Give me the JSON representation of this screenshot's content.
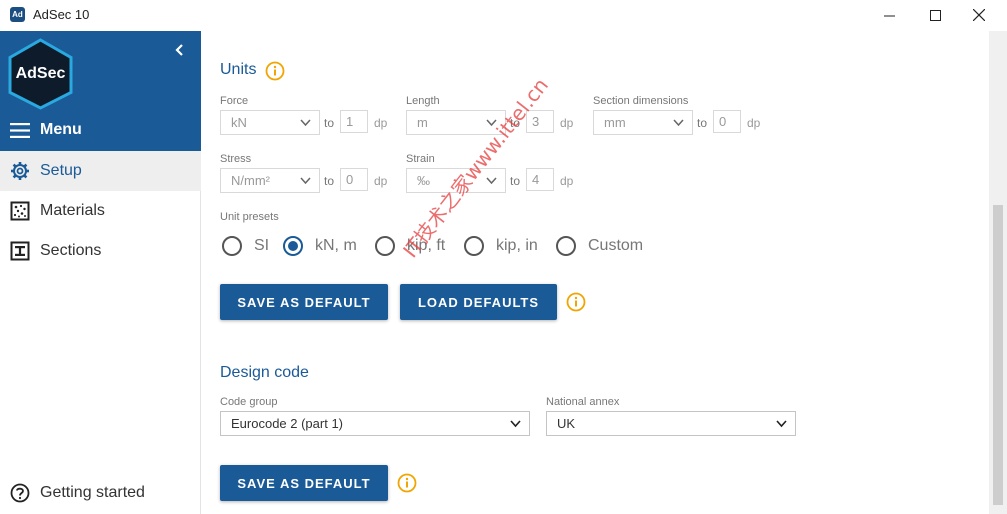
{
  "window": {
    "title": "AdSec 10",
    "icon_text": "Ad"
  },
  "sidebar": {
    "logo_text": "AdSec",
    "menu_label": "Menu",
    "items": [
      {
        "label": "Setup",
        "icon": "gear-icon",
        "active": true
      },
      {
        "label": "Materials",
        "icon": "materials-icon",
        "active": false
      },
      {
        "label": "Sections",
        "icon": "section-icon",
        "active": false
      }
    ],
    "footer_item": {
      "label": "Getting started",
      "icon": "help-icon"
    }
  },
  "units": {
    "title": "Units",
    "force": {
      "label": "Force",
      "value": "kN",
      "to": "to",
      "dp_value": "1",
      "dp": "dp"
    },
    "length": {
      "label": "Length",
      "value": "m",
      "to": "to",
      "dp_value": "3",
      "dp": "dp"
    },
    "section_dimensions": {
      "label": "Section dimensions",
      "value": "mm",
      "to": "to",
      "dp_value": "0",
      "dp": "dp"
    },
    "stress": {
      "label": "Stress",
      "value": "N/mm²",
      "to": "to",
      "dp_value": "0",
      "dp": "dp"
    },
    "strain": {
      "label": "Strain",
      "value": "‰",
      "to": "to",
      "dp_value": "4",
      "dp": "dp"
    },
    "presets_label": "Unit presets",
    "presets": [
      {
        "label": "SI",
        "checked": false
      },
      {
        "label": "kN, m",
        "checked": true
      },
      {
        "label": "kip, ft",
        "checked": false
      },
      {
        "label": "kip, in",
        "checked": false
      },
      {
        "label": "Custom",
        "checked": false
      }
    ],
    "save_default_label": "SAVE AS DEFAULT",
    "load_defaults_label": "LOAD DEFAULTS"
  },
  "design_code": {
    "title": "Design code",
    "code_group_label": "Code group",
    "code_group_value": "Eurocode 2 (part 1)",
    "national_annex_label": "National annex",
    "national_annex_value": "UK",
    "save_default_label": "SAVE AS DEFAULT"
  },
  "watermark": "IT技术之家www.ittel.cn",
  "colors": {
    "brand": "#1a5a97",
    "info": "#f0a500"
  }
}
